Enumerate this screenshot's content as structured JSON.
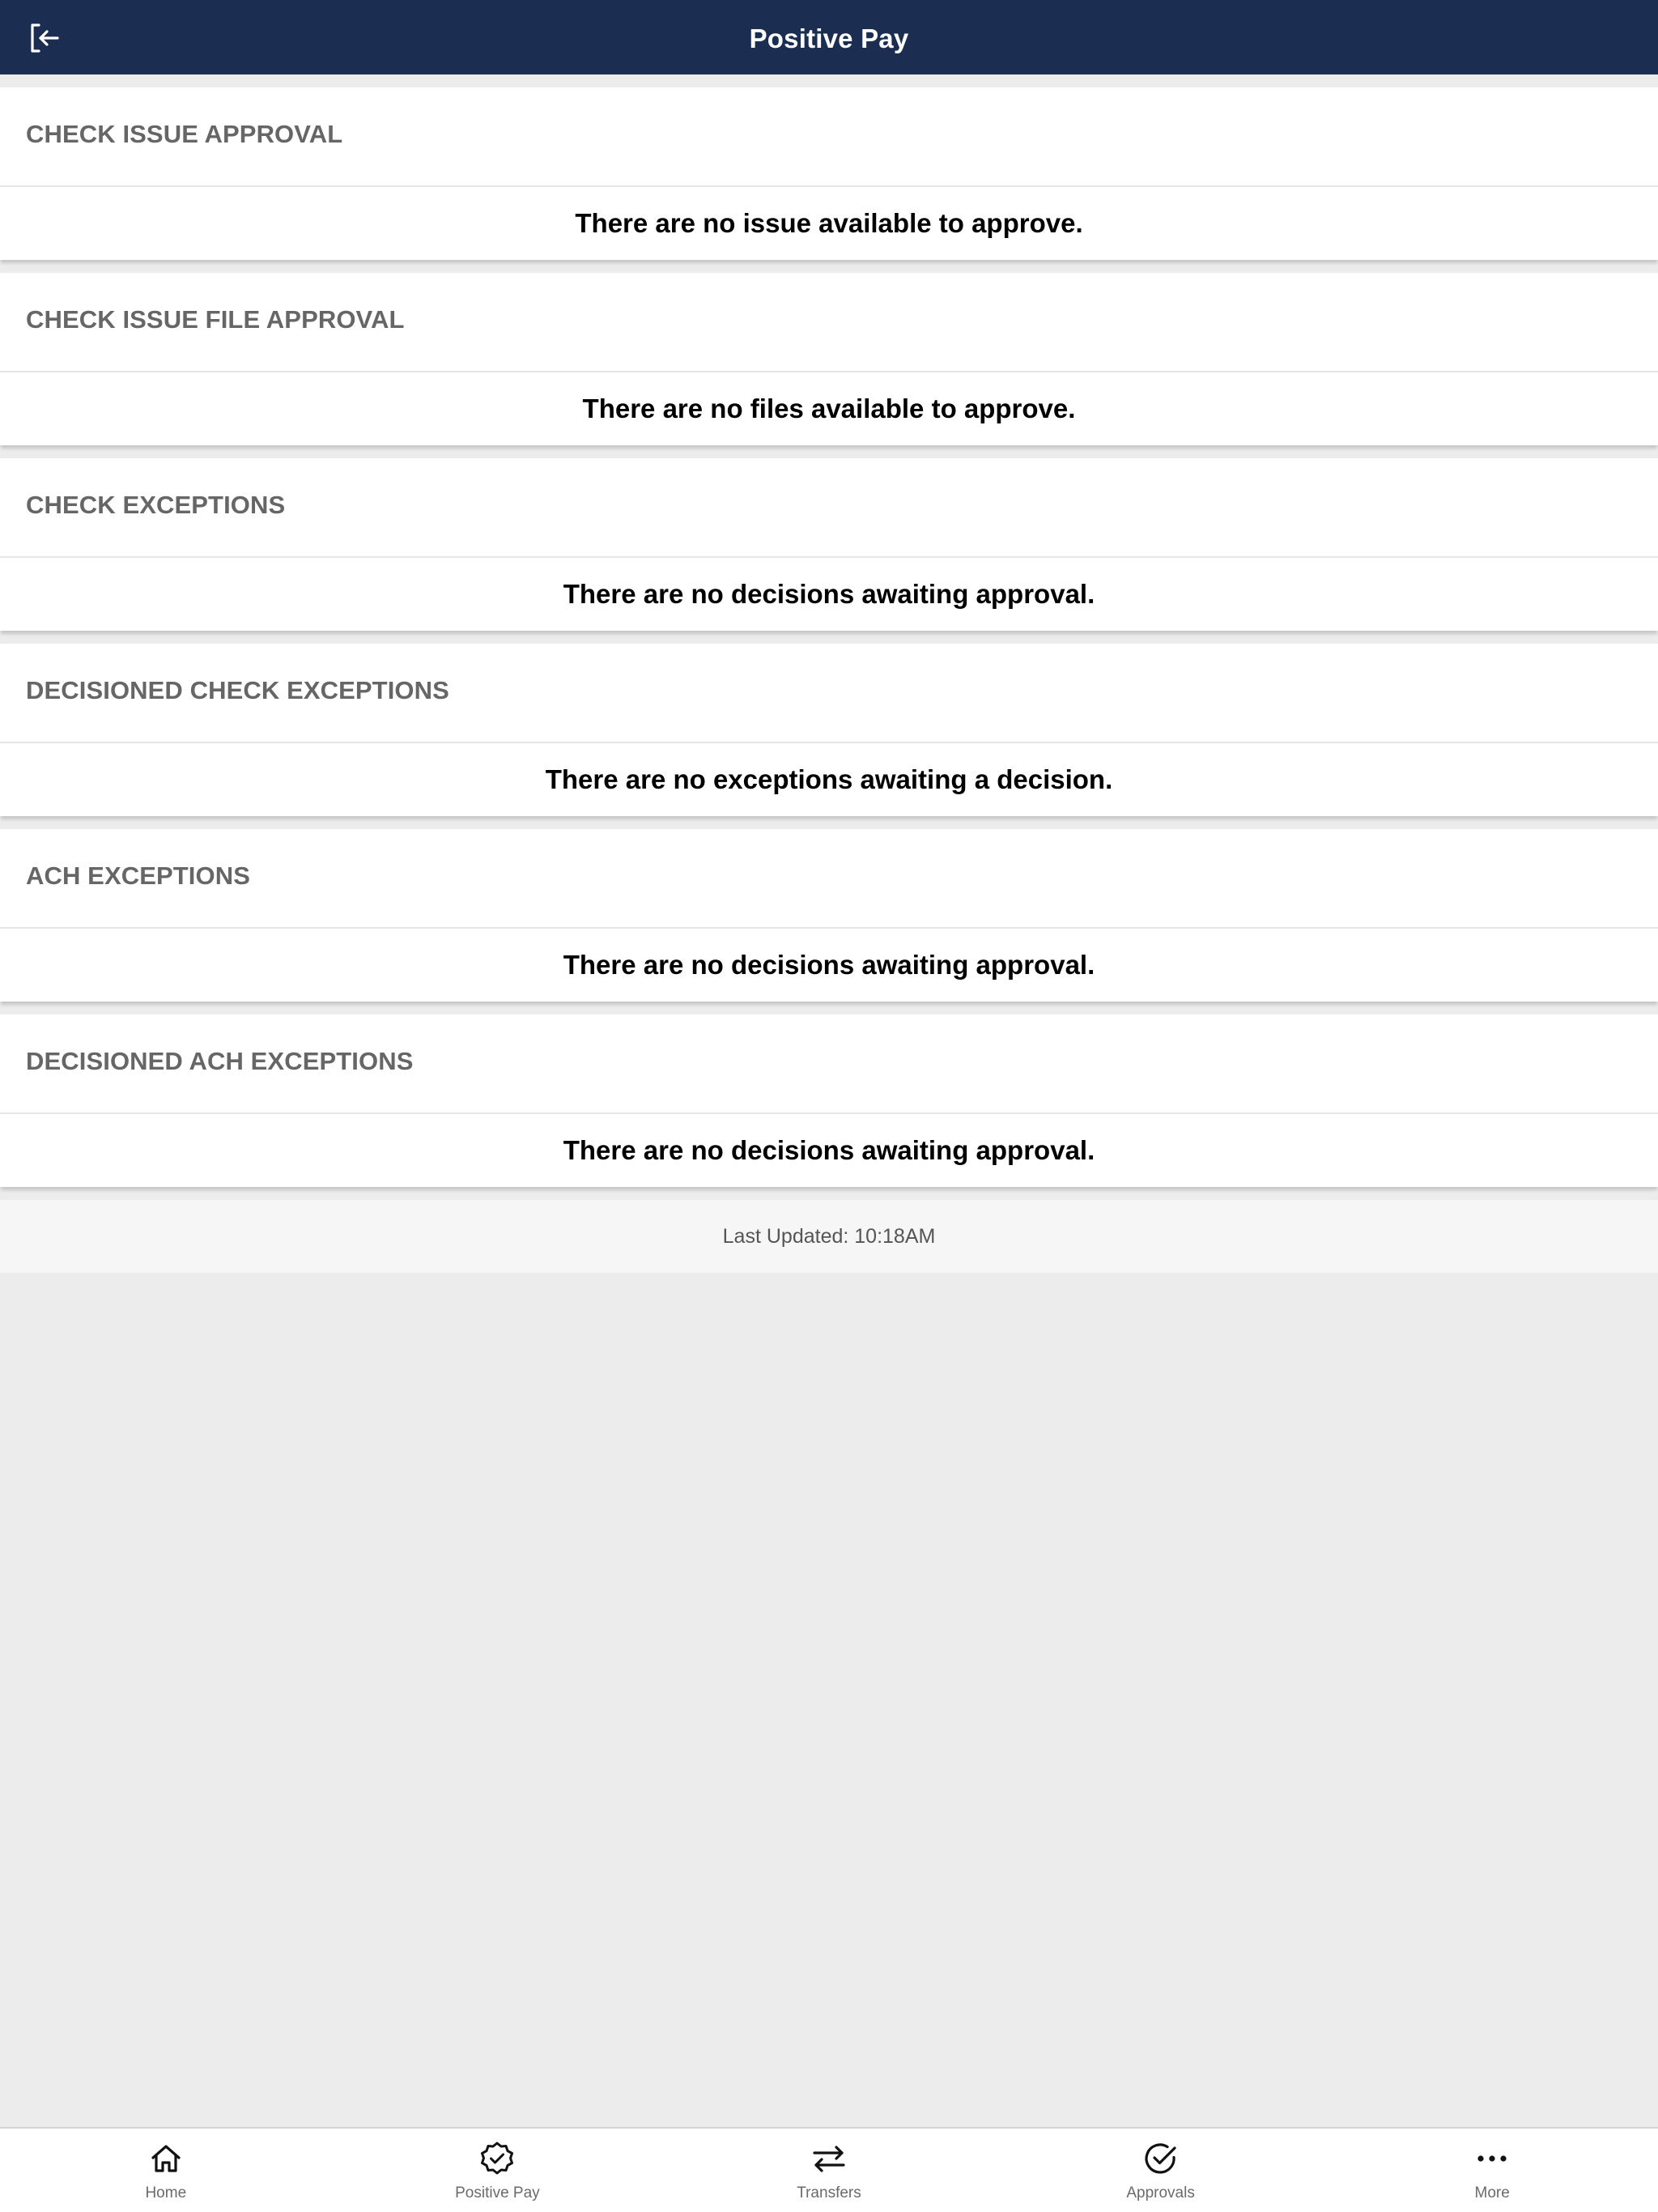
{
  "header": {
    "title": "Positive Pay",
    "back_icon": "logout-arrow-icon"
  },
  "sections": [
    {
      "title": "CHECK ISSUE APPROVAL",
      "message": "There are no issue available to approve."
    },
    {
      "title": "CHECK ISSUE FILE APPROVAL",
      "message": "There are no files available to approve."
    },
    {
      "title": "CHECK EXCEPTIONS",
      "message": "There are no decisions awaiting approval."
    },
    {
      "title": "DECISIONED CHECK EXCEPTIONS",
      "message": "There are no exceptions awaiting a decision."
    },
    {
      "title": "ACH EXCEPTIONS",
      "message": "There are no decisions awaiting approval."
    },
    {
      "title": "DECISIONED ACH EXCEPTIONS",
      "message": "There are no decisions awaiting approval."
    }
  ],
  "footer": {
    "last_updated": "Last Updated: 10:18AM"
  },
  "tabbar": {
    "items": [
      {
        "label": "Home",
        "icon": "home-icon"
      },
      {
        "label": "Positive Pay",
        "icon": "badge-check-icon"
      },
      {
        "label": "Transfers",
        "icon": "transfer-arrows-icon"
      },
      {
        "label": "Approvals",
        "icon": "circle-check-icon"
      },
      {
        "label": "More",
        "icon": "more-dots-icon"
      }
    ]
  },
  "colors": {
    "header_bg": "#1b2e51",
    "page_bg": "#ececec",
    "section_title": "#666666"
  }
}
